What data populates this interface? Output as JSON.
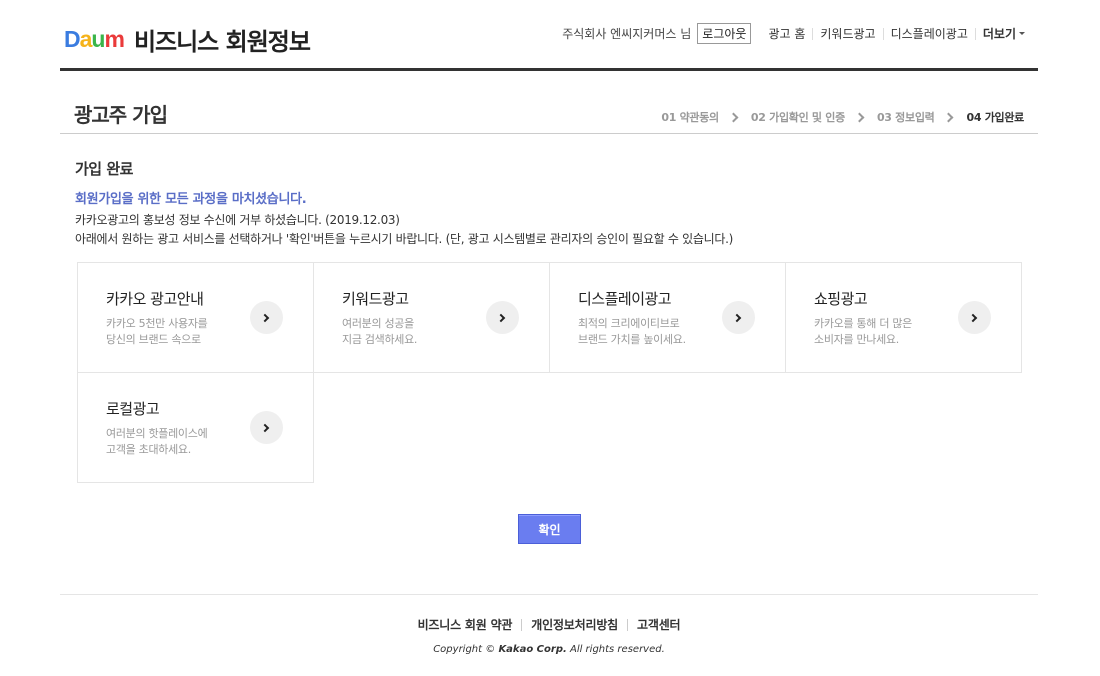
{
  "header": {
    "logo_letters": [
      {
        "ch": "D",
        "color": "#3a7ce0"
      },
      {
        "ch": "a",
        "color": "#f5b31b"
      },
      {
        "ch": "u",
        "color": "#3ab54a"
      },
      {
        "ch": "m",
        "color": "#ea3a3a"
      }
    ],
    "service_title": "비즈니스 회원정보",
    "user_label": "주식회사 엔씨지커머스 님",
    "logout_label": "로그아웃",
    "links": [
      "광고 홈",
      "키워드광고",
      "디스플레이광고"
    ],
    "more_label": "더보기"
  },
  "title_bar": {
    "page_title": "광고주 가입",
    "steps": [
      {
        "label": "01 약관동의",
        "active": false
      },
      {
        "label": "02 가입확인 및 인증",
        "active": false
      },
      {
        "label": "03 정보입력",
        "active": false
      },
      {
        "label": "04 가입완료",
        "active": true
      }
    ]
  },
  "content": {
    "section_title": "가입 완료",
    "complete_message": "회원가입을 위한 모든 과정을 마치셨습니다.",
    "info_line_1": "카카오광고의 홍보성 정보 수신에 거부 하셨습니다. (2019.12.03)",
    "info_line_2": "아래에서 원하는 광고 서비스를 선택하거나 '확인'버튼을 누르시기 바랍니다. (단, 광고 시스템별로 관리자의 승인이 필요할 수 있습니다.)"
  },
  "services": [
    {
      "id": "kakao-ad-guide",
      "name": "카카오 광고안내",
      "desc": [
        "카카오 5천만 사용자를",
        "당신의 브랜드 속으로"
      ]
    },
    {
      "id": "keyword-ad",
      "name": "키워드광고",
      "desc": [
        "여러분의 성공을",
        "지금 검색하세요."
      ]
    },
    {
      "id": "display-ad",
      "name": "디스플레이광고",
      "desc": [
        "최적의 크리에이티브로",
        "브랜드 가치를 높이세요."
      ]
    },
    {
      "id": "shopping-ad",
      "name": "쇼핑광고",
      "desc": [
        "카카오를 통해 더 많은",
        "소비자를 만나세요."
      ]
    },
    {
      "id": "local-ad",
      "name": "로컬광고",
      "desc": [
        "여러분의 핫플레이스에",
        "고객을 초대하세요."
      ]
    }
  ],
  "confirm_label": "확인",
  "footer": {
    "links": [
      "비즈니스 회원 약관",
      "개인정보처리방침",
      "고객센터"
    ],
    "copyright_prefix": "Copyright © ",
    "copyright_brand": "Kakao Corp.",
    "copyright_suffix": " All rights reserved."
  },
  "colors": {
    "accent": "#5a6ec7",
    "button": "#6a7df0"
  }
}
